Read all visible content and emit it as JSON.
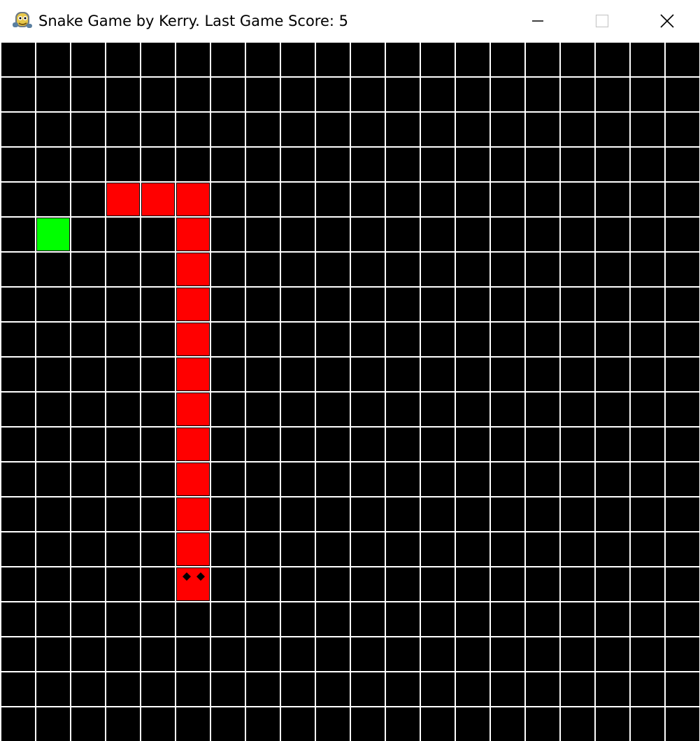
{
  "window": {
    "title": "Snake Game by Kerry. Last Game Score: 5",
    "icon": "snake-game-icon",
    "controls": [
      "minimize-icon",
      "maximize-icon",
      "close-icon"
    ]
  },
  "board": {
    "columns": 20,
    "rows": 20,
    "grid_lines": true,
    "colors": {
      "background": "#000000",
      "grid": "#ffffff",
      "snake": "#ff0000",
      "snake_eyes": "#000000",
      "food": "#00ff00"
    },
    "snake": {
      "head": [
        5,
        15
      ],
      "direction": "down",
      "segments": [
        [
          5,
          15
        ],
        [
          5,
          14
        ],
        [
          5,
          13
        ],
        [
          5,
          12
        ],
        [
          5,
          11
        ],
        [
          5,
          10
        ],
        [
          5,
          9
        ],
        [
          5,
          8
        ],
        [
          5,
          7
        ],
        [
          5,
          6
        ],
        [
          5,
          5
        ],
        [
          5,
          4
        ],
        [
          4,
          4
        ],
        [
          3,
          4
        ]
      ]
    },
    "food": [
      1,
      5
    ]
  }
}
